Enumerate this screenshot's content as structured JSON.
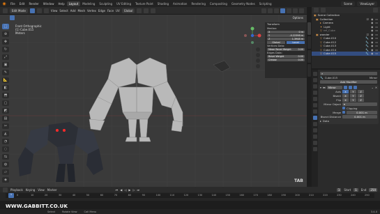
{
  "menubar": {
    "items": [
      "File",
      "Edit",
      "Render",
      "Window",
      "Help"
    ],
    "workspaces": [
      "Layout",
      "Modeling",
      "Sculpting",
      "UV Editing",
      "Texture Paint",
      "Shading",
      "Animation",
      "Rendering",
      "Compositing",
      "Geometry Nodes",
      "Scripting"
    ],
    "active_workspace": "Layout",
    "scene": "Scene",
    "view_layer": "ViewLayer"
  },
  "viewport_header": {
    "mode": "Edit Mode",
    "menus": [
      "View",
      "Select",
      "Add",
      "Mesh",
      "Vertex",
      "Edge",
      "Face",
      "UV"
    ],
    "orientation": "Global",
    "options": "Options"
  },
  "viewport_info": {
    "line1": "Front Orthographic",
    "line2": "(1) Cube.015",
    "line3": "Meters"
  },
  "npanel": {
    "title": "Transform",
    "median_label": "Median:",
    "x_label": "X",
    "x_value": "0 m",
    "y_label": "Y",
    "y_value": "-0.22398 m",
    "z_label": "Z",
    "z_value": "1.3948 m",
    "global": "Global",
    "local": "Local",
    "vertices_data": "Vertices Data:",
    "mean_bevel_label": "Mean Bevel Weight",
    "mean_bevel_value": "0.00",
    "edges_data": "Edges Data:",
    "bevel_label": "Bevel Weight",
    "bevel_value": "0.00",
    "crease_label": "Crease",
    "crease_value": "0.00"
  },
  "outliner": {
    "title": "Scene Collection",
    "rows": [
      {
        "label": "Scene Collection",
        "sel": false
      },
      {
        "label": "Collection",
        "sel": false
      },
      {
        "label": "Camera",
        "sel": false
      },
      {
        "label": "Light",
        "sel": false
      },
      {
        "label": "ref_Cube",
        "sel": false
      },
      {
        "label": "wonder",
        "sel": false
      },
      {
        "label": "Cube.010",
        "sel": false
      },
      {
        "label": "Cube.012",
        "sel": false
      },
      {
        "label": "Cube.013",
        "sel": false
      },
      {
        "label": "Cube.014",
        "sel": false
      },
      {
        "label": "Cube.015",
        "sel": true
      }
    ]
  },
  "properties": {
    "object_name": "Cube.015",
    "modifier_tab": "Mirror",
    "add_modifier": "Add Modifier",
    "modifier_name": "Mirror",
    "axis_label": "Axis",
    "bisect_label": "Bisect",
    "flip_label": "Flip",
    "axes": [
      "X",
      "Y",
      "Z"
    ],
    "mirror_object_label": "Mirror Object",
    "clipping_label": "Clipping",
    "merge_label": "Merge",
    "merge_value": "0.001 m",
    "bisect_distance_label": "Bisect Distance",
    "bisect_distance_value": "0.001 m",
    "data_label": "Data"
  },
  "timeline": {
    "menus": [
      "Playback",
      "Keying",
      "View",
      "Marker"
    ],
    "current_frame": "1",
    "start_label": "Start",
    "start_value": "1",
    "end_label": "End",
    "end_value": "250",
    "ticks": [
      "0",
      "10",
      "20",
      "30",
      "40",
      "50",
      "60",
      "70",
      "80",
      "90",
      "100",
      "110",
      "120",
      "130",
      "140",
      "150",
      "160",
      "170",
      "180",
      "190",
      "200",
      "210",
      "220",
      "230",
      "240",
      "250"
    ]
  },
  "status": {
    "items": [
      "Select",
      "Rotate View",
      "Call Menu"
    ],
    "version": "3.4.0"
  },
  "overlay": {
    "watermark": "WWW.GABBITT.CO.UK",
    "tab_badge": "TAB"
  },
  "colors": {
    "accent": "#4772b3",
    "viewport_bg": "#3a3a3a",
    "selected_row": "#334d80"
  }
}
